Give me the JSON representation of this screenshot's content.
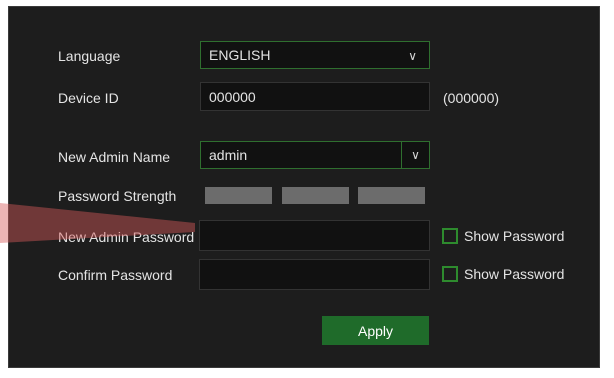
{
  "form": {
    "language": {
      "label": "Language",
      "value": "ENGLISH"
    },
    "device_id": {
      "label": "Device ID",
      "value": "000000",
      "hint": "(000000)"
    },
    "admin_name": {
      "label": "New Admin Name",
      "value": "admin"
    },
    "password_strength": {
      "label": "Password Strength"
    },
    "admin_password": {
      "label": "New Admin Password",
      "value": "",
      "show_label": "Show Password"
    },
    "confirm_password": {
      "label": "Confirm Password",
      "value": "",
      "show_label": "Show Password"
    },
    "apply_label": "Apply"
  },
  "colors": {
    "panel_bg": "#1d1d1d",
    "field_border": "#2f6f2f",
    "accent_green": "#1f6b2a",
    "strength_bar": "#6c6c6c",
    "overlay_red": "#d65a5a"
  },
  "icons": {
    "dropdown": "chevron-down-icon"
  }
}
